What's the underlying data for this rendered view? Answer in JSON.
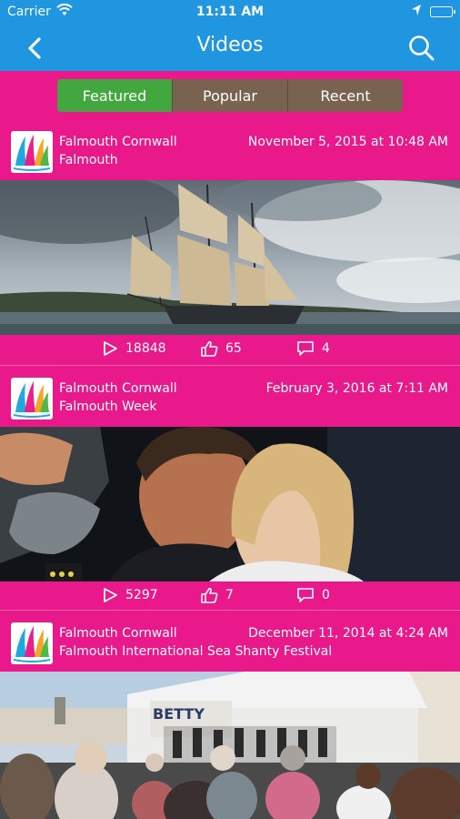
{
  "status_bar": {
    "carrier": "Carrier",
    "time": "11:11 AM"
  },
  "nav": {
    "title": "Videos"
  },
  "tabs": [
    {
      "label": "Featured",
      "active": true
    },
    {
      "label": "Popular",
      "active": false
    },
    {
      "label": "Recent",
      "active": false
    }
  ],
  "posts": [
    {
      "org": "Falmouth Cornwall",
      "place": "Falmouth",
      "date": "November 5, 2015 at 10:48 AM",
      "thumbnail": "tall-ship-sailing",
      "plays": "18848",
      "likes": "65",
      "comments": "4"
    },
    {
      "org": "Falmouth Cornwall",
      "place": "Falmouth Week",
      "date": "February 3, 2016 at 7:11 AM",
      "thumbnail": "man-and-child",
      "plays": "5297",
      "likes": "7",
      "comments": "0"
    },
    {
      "org": "Falmouth Cornwall",
      "place": "Falmouth International Sea Shanty Festival",
      "date": "December 11, 2014 at 4:24 AM",
      "thumbnail": "festival-crowd-stage"
    }
  ],
  "colors": {
    "nav_blue": "#2196e0",
    "content_pink": "#e9198c",
    "tab_active_green": "#43a740",
    "tab_inactive_brown": "#7a6250"
  }
}
